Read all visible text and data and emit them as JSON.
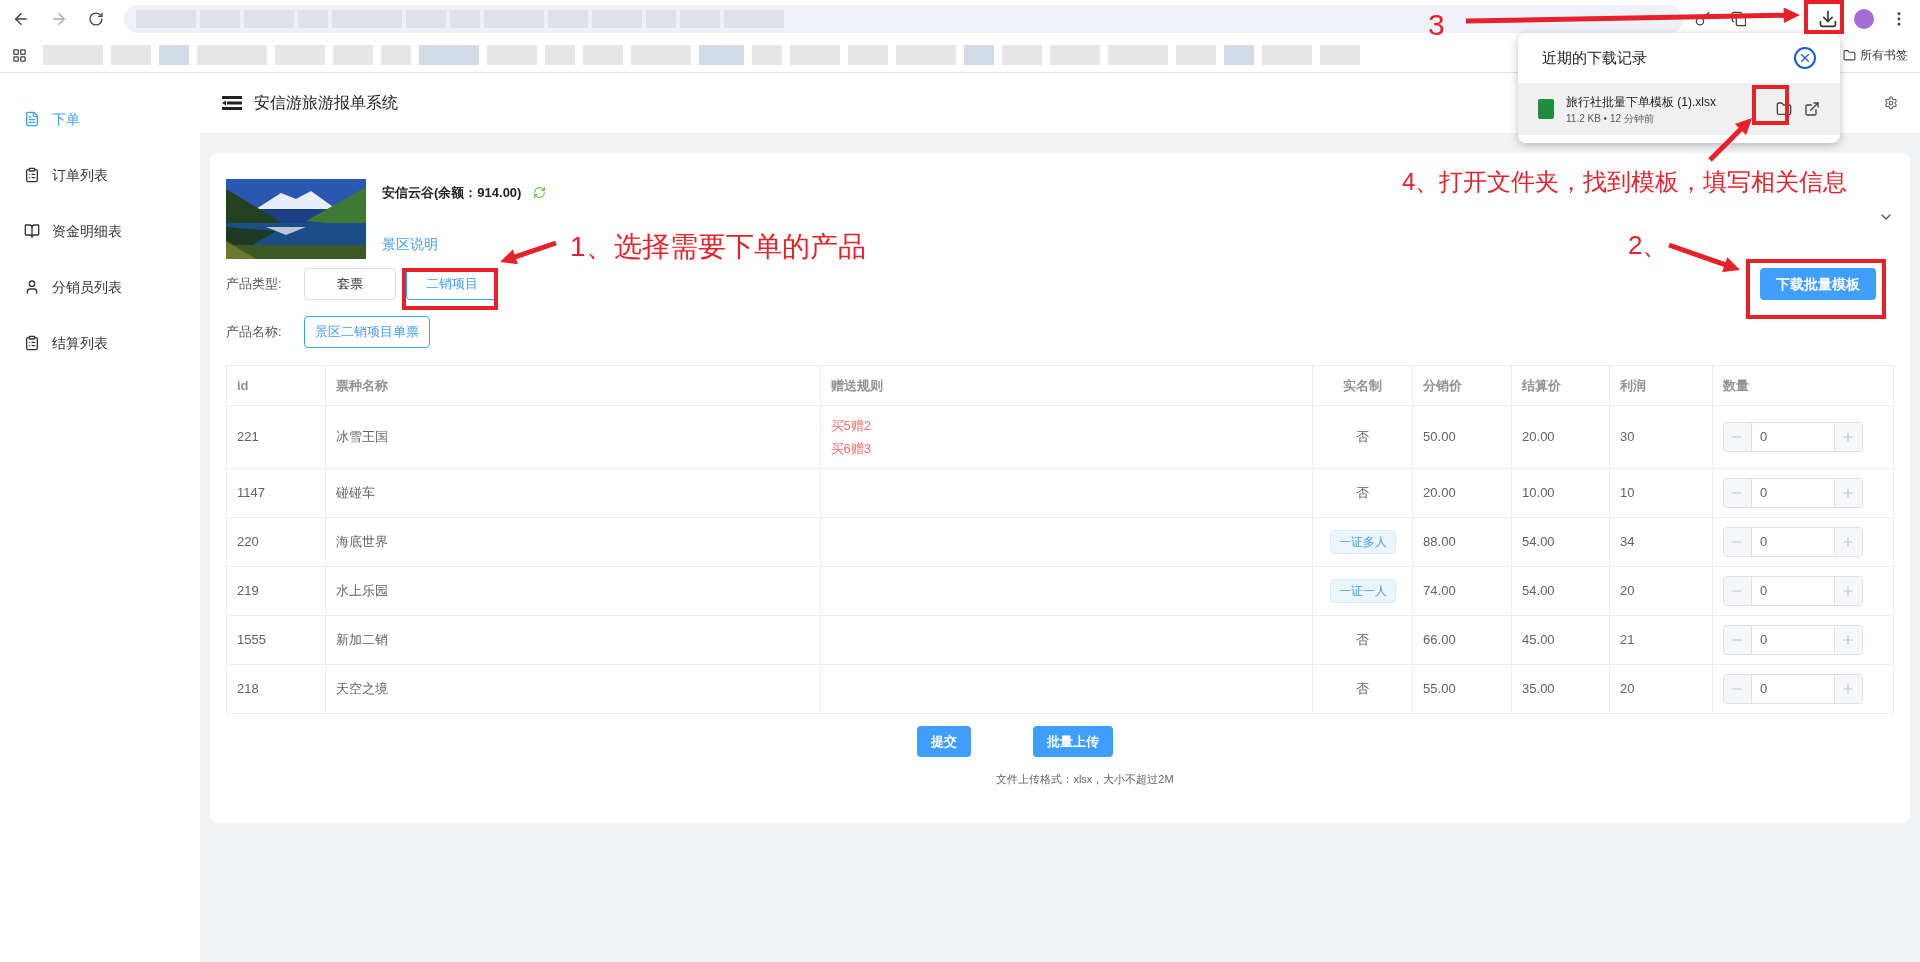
{
  "browser": {
    "bookmarks_all": "所有书签"
  },
  "download_popup": {
    "title": "近期的下载记录",
    "file": {
      "name": "旅行社批量下单模板 (1).xlsx",
      "meta": "11.2 KB • 12 分钟前"
    }
  },
  "sidebar": {
    "items": [
      {
        "label": "下单",
        "selected": true
      },
      {
        "label": "订单列表",
        "selected": false
      },
      {
        "label": "资金明细表",
        "selected": false
      },
      {
        "label": "分销员列表",
        "selected": false
      },
      {
        "label": "结算列表",
        "selected": false
      }
    ]
  },
  "header": {
    "title": "安信游旅游报单系统"
  },
  "product": {
    "kind": "picture",
    "name": "安信云谷(余额：914.00)",
    "link": "景区说明"
  },
  "type_filter": {
    "label": "产品类型:",
    "options": [
      {
        "label": "套票",
        "selected": false
      },
      {
        "label": "二销项目",
        "selected": true
      }
    ]
  },
  "name_filter": {
    "label": "产品名称:",
    "options": [
      {
        "label": "景区二销项目单票",
        "selected": true
      }
    ]
  },
  "download_button": "下载批量模板",
  "table": {
    "columns": [
      "id",
      "票种名称",
      "赠送规则",
      "实名制",
      "分销价",
      "结算价",
      "利润",
      "数量"
    ],
    "rows": [
      {
        "id": "221",
        "name": "冰雪王国",
        "rules": [
          "买5赠2",
          "买6赠3"
        ],
        "real_name": {
          "kind": "text",
          "text": "否"
        },
        "price": "50.00",
        "settle": "20.00",
        "profit": "30",
        "qty": "0"
      },
      {
        "id": "1147",
        "name": "碰碰车",
        "rules": [],
        "real_name": {
          "kind": "text",
          "text": "否"
        },
        "price": "20.00",
        "settle": "10.00",
        "profit": "10",
        "qty": "0"
      },
      {
        "id": "220",
        "name": "海底世界",
        "rules": [],
        "real_name": {
          "kind": "tag",
          "text": "一证多人"
        },
        "price": "88.00",
        "settle": "54.00",
        "profit": "34",
        "qty": "0"
      },
      {
        "id": "219",
        "name": "水上乐园",
        "rules": [],
        "real_name": {
          "kind": "tag",
          "text": "一证一人"
        },
        "price": "74.00",
        "settle": "54.00",
        "profit": "20",
        "qty": "0"
      },
      {
        "id": "1555",
        "name": "新加二销",
        "rules": [],
        "real_name": {
          "kind": "text",
          "text": "否"
        },
        "price": "66.00",
        "settle": "45.00",
        "profit": "21",
        "qty": "0"
      },
      {
        "id": "218",
        "name": "天空之境",
        "rules": [],
        "real_name": {
          "kind": "text",
          "text": "否"
        },
        "price": "55.00",
        "settle": "35.00",
        "profit": "20",
        "qty": "0"
      }
    ]
  },
  "actions": [
    "提交",
    "批量上传"
  ],
  "upload_hint": "文件上传格式：xlsx，大小不超过2M",
  "annotations": [
    {
      "text": "1、选择需要下单的产品"
    },
    {
      "text": "2、"
    },
    {
      "text": "3"
    },
    {
      "text": "4、打开文件夹，找到模板，填写相关信息"
    }
  ]
}
